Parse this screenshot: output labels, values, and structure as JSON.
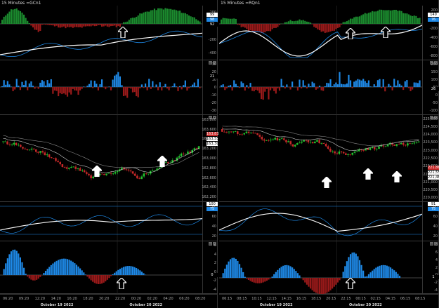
{
  "left": {
    "title": "15 Minutes  =GCn1",
    "osc1": {
      "ticks": [
        "200",
        "0",
        "-200",
        "-400"
      ],
      "tags": [
        {
          "text": "99",
          "bg": "#ffffff",
          "fg": "#000"
        },
        {
          "text": "98",
          "bg": "#1e88e5",
          "fg": "#fff"
        },
        {
          "text": "92",
          "bg": "#000",
          "fg": "#fff"
        }
      ]
    },
    "hist1": {
      "ticks": [
        "30",
        "20",
        "10",
        "0",
        "-10",
        "-20",
        "-30"
      ],
      "tag": "21"
    },
    "price": {
      "ticks": [
        "163,800",
        "163,600",
        "163,400",
        "163,200",
        "163,000",
        "162,800",
        "162,600",
        "162,400",
        "162,200"
      ],
      "tags": [
        {
          "text": "163,833",
          "bg": "#c62828",
          "fg": "#fff"
        },
        {
          "text": "163,551",
          "bg": "#ffffff",
          "fg": "#000"
        },
        {
          "text": "163,303",
          "bg": "#ffffff",
          "fg": "#000"
        }
      ]
    },
    "osc2": {
      "ticks": [
        "80",
        "60",
        "40",
        "20"
      ],
      "tags": [
        {
          "text": "100",
          "bg": "#ffffff",
          "fg": "#000"
        },
        {
          "text": "75",
          "bg": "#1e88e5",
          "fg": "#fff"
        }
      ]
    },
    "hist2": {
      "ticks": [
        "6",
        "4",
        "2",
        "0",
        "-2",
        "-4"
      ],
      "tag": "0"
    },
    "times": [
      "06:20",
      "09:20",
      "12:20",
      "14:20",
      "16:20",
      "18:20",
      "20:20",
      "22:20",
      "00:20",
      "02:20",
      "04:20",
      "06:20",
      "08:20"
    ],
    "dates": [
      "October 19 2022",
      "October 20 2022"
    ]
  },
  "right": {
    "title": "15 Minutes  =RQn1",
    "osc1": {
      "ticks": [
        "200",
        "0",
        "-200",
        "-400",
        "-600",
        "-800"
      ],
      "tags": [
        {
          "text": "140",
          "bg": "#ffffff",
          "fg": "#000"
        },
        {
          "text": "76",
          "bg": "#1e88e5",
          "fg": "#fff"
        }
      ]
    },
    "hist1": {
      "ticks": [
        "200",
        "150",
        "100",
        "50",
        "0",
        "-50",
        "-100"
      ],
      "tag": "26"
    },
    "price": {
      "ticks": [
        "225,000",
        "224,500",
        "224,000",
        "223,500",
        "223,000",
        "222,500",
        "222,000",
        "221,500",
        "221,000",
        "220,500",
        "220,000"
      ],
      "tags": [
        {
          "text": "221,868",
          "bg": "#c62828",
          "fg": "#fff"
        },
        {
          "text": "221,557",
          "bg": "#ffffff",
          "fg": "#000"
        },
        {
          "text": "221,481",
          "bg": "#ffffff",
          "fg": "#000"
        }
      ]
    },
    "osc2": {
      "ticks": [
        "80",
        "60",
        "40",
        "20"
      ],
      "tags": [
        {
          "text": "91",
          "bg": "#ffffff",
          "fg": "#000"
        },
        {
          "text": "75",
          "bg": "#1e88e5",
          "fg": "#fff"
        }
      ]
    },
    "hist2": {
      "ticks": [
        "8",
        "6",
        "4",
        "2",
        "0",
        "-2",
        "-4"
      ],
      "tag": "1"
    },
    "times": [
      "06:15",
      "08:15",
      "10:15",
      "12:15",
      "14:15",
      "16:15",
      "18:15",
      "20:15",
      "22:15",
      "00:15",
      "02:15",
      "04:15",
      "06:15",
      "08:15"
    ],
    "dates": [
      "October 19 2022",
      "October 20 2022"
    ]
  },
  "colors": {
    "up": "#22c22e",
    "down": "#c62828",
    "blue": "#1e88e5",
    "white": "#ffffff",
    "grid": "#222222"
  }
}
